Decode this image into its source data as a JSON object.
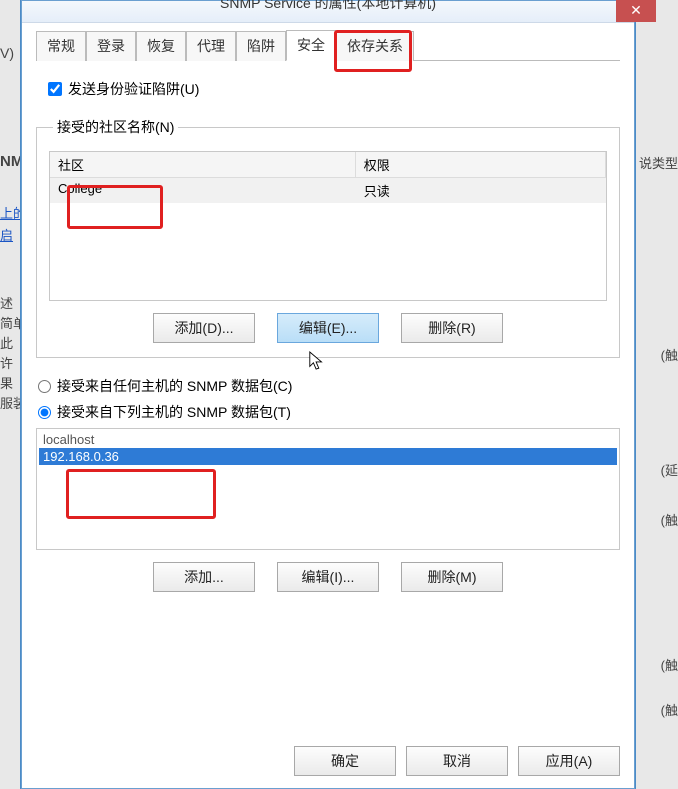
{
  "window": {
    "title": "SNMP Service 的属性(本地计算机)"
  },
  "tabs": {
    "general": "常规",
    "logon": "登录",
    "recovery": "恢复",
    "agent": "代理",
    "trap": "陷阱",
    "security": "安全",
    "dependencies": "依存关系"
  },
  "checkbox": {
    "sendAuthTrap": "发送身份验证陷阱(U)"
  },
  "communities": {
    "legend": "接受的社区名称(N)",
    "headerCommunity": "社区",
    "headerPermission": "权限",
    "row": {
      "name": "College",
      "permission": "只读"
    },
    "addBtn": "添加(D)...",
    "editBtn": "编辑(E)...",
    "removeBtn": "删除(R)"
  },
  "hosts": {
    "radioAny": "接受来自任何主机的 SNMP 数据包(C)",
    "radioThese": "接受来自下列主机的 SNMP 数据包(T)",
    "items": [
      "localhost",
      "192.168.0.36"
    ],
    "addBtn": "添加...",
    "editBtn": "编辑(I)...",
    "removeBtn": "删除(M)"
  },
  "dialogButtons": {
    "ok": "确定",
    "cancel": "取消",
    "apply": "应用(A)"
  },
  "bg": {
    "v": "V)",
    "nm": "NM",
    "link1": "上的",
    "link2": "启",
    "t1": "述",
    "t2": "简单",
    "t3": "此",
    "t4": "许",
    "t5": "果",
    "t6": "服装",
    "r1": "说类型",
    "r2": "(触",
    "r3": "(延",
    "r4": "(触",
    "r5": "(触",
    "r6": "(触"
  }
}
